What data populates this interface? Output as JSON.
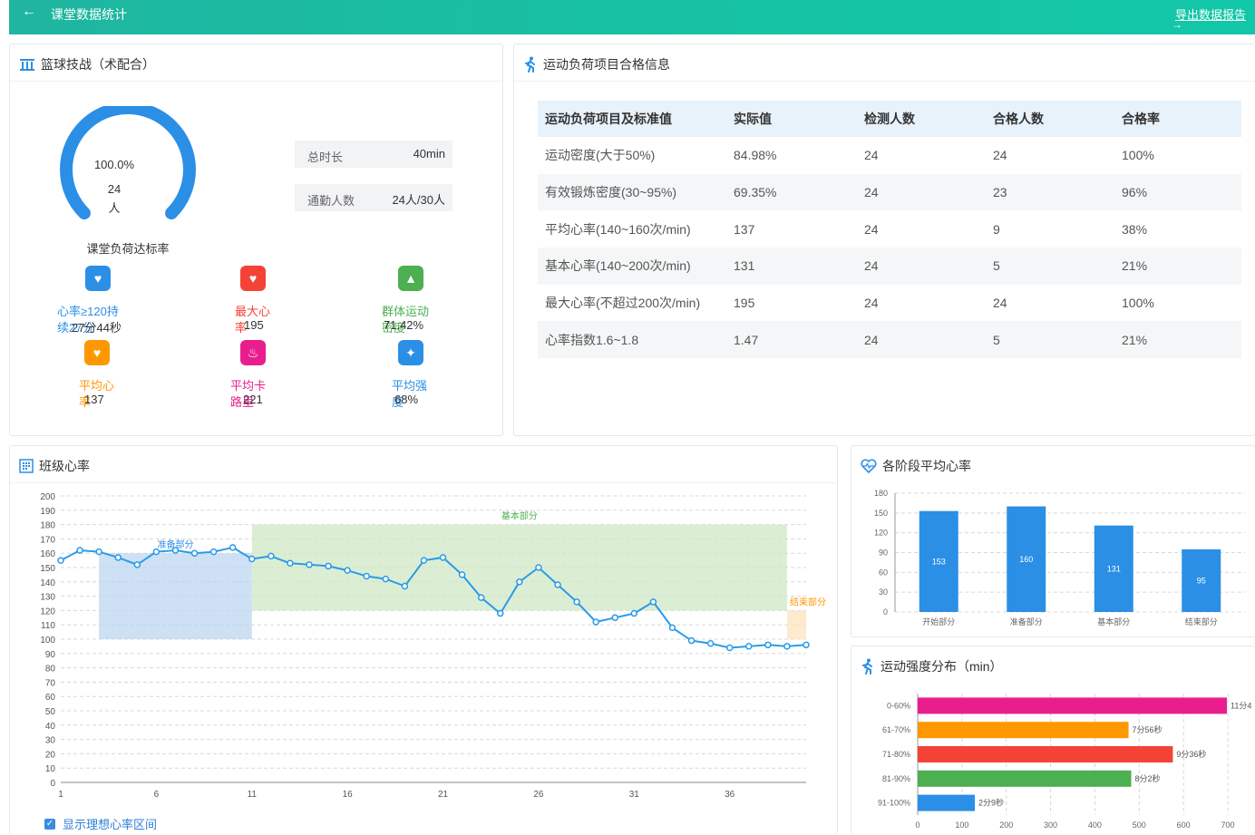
{
  "header": {
    "back_icon": "←",
    "title": "课堂数据统计",
    "export_label": "导出数据报告",
    "export_arrow": "→"
  },
  "panel_tactics": {
    "title": "篮球技战（术配合）",
    "gauge": {
      "percent_label": "100.0%",
      "fraction": 1.0,
      "count": "24",
      "unit": "人",
      "caption": "课堂负荷达标率",
      "color": "#2b8fe6"
    },
    "info": [
      {
        "key": "总时长",
        "value": "40min"
      },
      {
        "key": "通勤人数",
        "value": "24人/30人"
      }
    ],
    "stats": [
      {
        "icon": "heart-monitor-icon",
        "color": "#2b8fe6",
        "label": "心率≥120持",
        "overlay": "续27分",
        "value": "27分44秒",
        "label_color": "#2b8fe6",
        "overlay_color": "#2b8fe6"
      },
      {
        "icon": "heart-pulse-icon",
        "color": "#f44336",
        "label": "最大心",
        "overlay": "率",
        "value": "195",
        "label_color": "#f44336",
        "overlay_color": "#f44336"
      },
      {
        "icon": "chart-icon",
        "color": "#4caf50",
        "label": "群体运动",
        "overlay": "密度",
        "value": "71.42%",
        "label_color": "#4caf50",
        "overlay_color": "#4caf50"
      },
      {
        "icon": "heart-avg-icon",
        "color": "#ff9800",
        "label": "平均心",
        "overlay": "率",
        "value": "137",
        "label_color": "#ff9800",
        "overlay_color": "#ff9800"
      },
      {
        "icon": "flame-icon",
        "color": "#e91e8c",
        "label": "平均卡",
        "overlay": "路里",
        "value": "221",
        "label_color": "#e91e8c",
        "overlay_color": "#e91e8c"
      },
      {
        "icon": "runner-icon",
        "color": "#2b8fe6",
        "label": "平均强",
        "overlay": "度",
        "value": "68%",
        "label_color": "#2b8fe6",
        "overlay_color": "#2b8fe6"
      }
    ]
  },
  "panel_load": {
    "title": "运动负荷项目合格信息",
    "columns": [
      "运动负荷项目及标准值",
      "实际值",
      "检测人数",
      "合格人数",
      "合格率"
    ],
    "rows": [
      [
        "运动密度(大于50%)",
        "84.98%",
        "24",
        "24",
        "100%"
      ],
      [
        "有效锻炼密度(30~95%)",
        "69.35%",
        "24",
        "23",
        "96%"
      ],
      [
        "平均心率(140~160次/min)",
        "137",
        "24",
        "9",
        "38%"
      ],
      [
        "基本心率(140~200次/min)",
        "131",
        "24",
        "5",
        "21%"
      ],
      [
        "最大心率(不超过200次/min)",
        "195",
        "24",
        "24",
        "100%"
      ],
      [
        "心率指数1.6~1.8",
        "1.47",
        "24",
        "5",
        "21%"
      ]
    ]
  },
  "panel_class_hr": {
    "title": "班级心率",
    "checkbox_label": "显示理想心率区间",
    "checkbox_mark": "✓"
  },
  "panel_stage_hr": {
    "title": "各阶段平均心率"
  },
  "panel_intensity": {
    "title": "运动强度分布（min）"
  },
  "chart_data": [
    {
      "type": "line",
      "x": [
        1,
        2,
        3,
        4,
        5,
        6,
        7,
        8,
        9,
        10,
        11,
        12,
        13,
        14,
        15,
        16,
        17,
        18,
        19,
        20,
        21,
        22,
        23,
        24,
        25,
        26,
        27,
        28,
        29,
        30,
        31,
        32,
        33,
        34,
        35,
        36,
        37,
        38,
        39,
        40
      ],
      "y": [
        155,
        162,
        161,
        157,
        152,
        161,
        162,
        160,
        161,
        164,
        156,
        158,
        153,
        152,
        151,
        148,
        144,
        142,
        137,
        155,
        157,
        145,
        129,
        118,
        140,
        150,
        138,
        126,
        112,
        115,
        118,
        126,
        108,
        99,
        97,
        94,
        95,
        96,
        95,
        96
      ],
      "ylim": [
        0,
        200
      ],
      "yticks": [
        0,
        10,
        20,
        30,
        40,
        50,
        60,
        70,
        80,
        90,
        100,
        110,
        120,
        130,
        140,
        150,
        160,
        170,
        180,
        190,
        200
      ],
      "xticks": [
        1,
        6,
        11,
        16,
        21,
        26,
        31,
        36
      ],
      "line_color": "#2b9be8",
      "zones": [
        {
          "label": "准备部分",
          "x0": 3,
          "x1": 11,
          "y0": 100,
          "y1": 160,
          "color": "#bcd6f0",
          "text_color": "#2b8fe6"
        },
        {
          "label": "基本部分",
          "x0": 11,
          "x1": 39,
          "y0": 120,
          "y1": 180,
          "color": "#cfe8c6",
          "text_color": "#4caf50"
        },
        {
          "label": "结束部分",
          "x0": 39,
          "x1": 40,
          "y0": 100,
          "y1": 120,
          "color": "#fde3bd",
          "text_color": "#ff9800"
        }
      ]
    },
    {
      "type": "bar",
      "categories": [
        "开始部分",
        "准备部分",
        "基本部分",
        "结束部分"
      ],
      "values": [
        153,
        160,
        131,
        95
      ],
      "ylim": [
        0,
        180
      ],
      "yticks": [
        0,
        30,
        60,
        90,
        120,
        150,
        180
      ],
      "color": "#2b8fe6"
    },
    {
      "type": "bar",
      "orientation": "horizontal",
      "categories": [
        "0-60%",
        "61-70%",
        "71-80%",
        "81-90%",
        "91-100%"
      ],
      "values": [
        698,
        476,
        576,
        482,
        129
      ],
      "value_labels": [
        "11分4",
        "7分56秒",
        "9分36秒",
        "8分2秒",
        "2分9秒"
      ],
      "colors": [
        "#e91e8c",
        "#ff9800",
        "#f44336",
        "#4caf50",
        "#2b8fe6"
      ],
      "xlim": [
        0,
        700
      ],
      "xticks": [
        0,
        100,
        200,
        300,
        400,
        500,
        600,
        700
      ]
    }
  ]
}
